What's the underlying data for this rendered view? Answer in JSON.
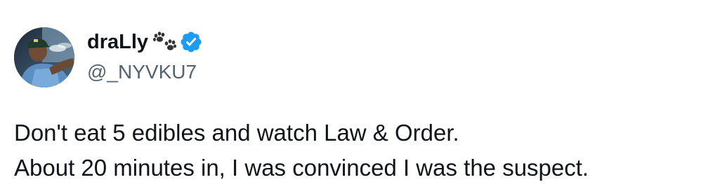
{
  "author": {
    "display_name": "draLly",
    "handle": "@_NYVKU7",
    "name_emoji_icon": "paw-prints-icon",
    "verified_icon": "verified-badge-icon",
    "verified_color": "#1d9bf0"
  },
  "tweet": {
    "lines": [
      "Don't eat 5 edibles and watch Law & Order.",
      "About 20 minutes in, I was convinced I was the suspect."
    ]
  },
  "colors": {
    "text_primary": "#0f1419",
    "text_secondary": "#536471",
    "background": "#ffffff"
  }
}
